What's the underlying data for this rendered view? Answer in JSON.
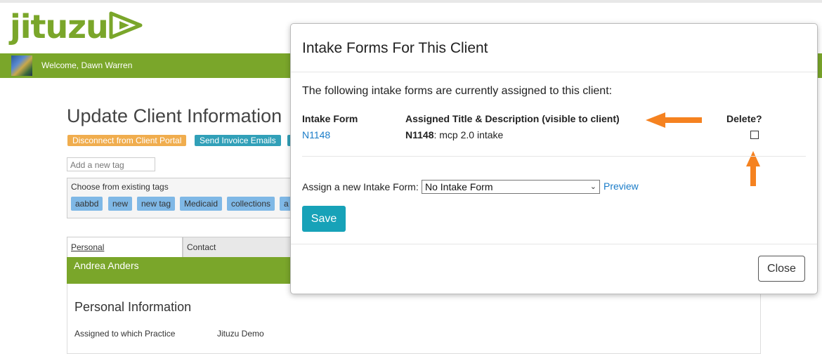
{
  "app": {
    "logo_text": "jituzu",
    "brand_color": "#7aa62a",
    "welcome": "Welcome, Dawn Warren"
  },
  "page": {
    "title": "Update Client Information",
    "buttons": {
      "disconnect": "Disconnect from Client Portal",
      "send_invoice": "Send Invoice Emails"
    },
    "tag_input_placeholder": "Add a new tag",
    "tags_label": "Choose from existing tags",
    "tags": [
      "aabbd",
      "new",
      "new tag",
      "Medicaid",
      "collections",
      "a"
    ],
    "tabs": [
      "Personal",
      "Contact"
    ],
    "client_name": "Andrea Anders",
    "section_title": "Personal Information",
    "fields": [
      {
        "label": "Assigned to which Practice",
        "value": "Jituzu Demo"
      }
    ]
  },
  "modal": {
    "title": "Intake Forms For This Client",
    "intro": "The following intake forms are currently assigned to this client:",
    "columns": {
      "form": "Intake Form",
      "title_desc": "Assigned Title & Description (visible to client)",
      "delete": "Delete?"
    },
    "rows": [
      {
        "form": "N1148",
        "title": "N1148",
        "description": ": mcp 2.0 intake",
        "delete": false
      }
    ],
    "assign_label": "Assign a new Intake Form:",
    "assign_selected": "No Intake Form",
    "preview_label": "Preview",
    "save_label": "Save",
    "close_label": "Close",
    "accent_color": "#17a2b8",
    "annotation_arrow_color": "#f58220"
  }
}
